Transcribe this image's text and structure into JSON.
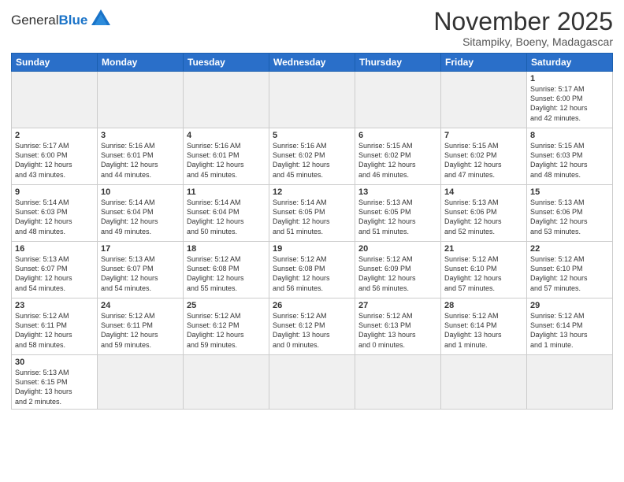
{
  "logo": {
    "text_general": "General",
    "text_blue": "Blue"
  },
  "title": "November 2025",
  "location": "Sitampiky, Boeny, Madagascar",
  "days_of_week": [
    "Sunday",
    "Monday",
    "Tuesday",
    "Wednesday",
    "Thursday",
    "Friday",
    "Saturday"
  ],
  "weeks": [
    [
      {
        "day": "",
        "info": ""
      },
      {
        "day": "",
        "info": ""
      },
      {
        "day": "",
        "info": ""
      },
      {
        "day": "",
        "info": ""
      },
      {
        "day": "",
        "info": ""
      },
      {
        "day": "",
        "info": ""
      },
      {
        "day": "1",
        "info": "Sunrise: 5:17 AM\nSunset: 6:00 PM\nDaylight: 12 hours\nand 42 minutes."
      }
    ],
    [
      {
        "day": "2",
        "info": "Sunrise: 5:17 AM\nSunset: 6:00 PM\nDaylight: 12 hours\nand 43 minutes."
      },
      {
        "day": "3",
        "info": "Sunrise: 5:16 AM\nSunset: 6:01 PM\nDaylight: 12 hours\nand 44 minutes."
      },
      {
        "day": "4",
        "info": "Sunrise: 5:16 AM\nSunset: 6:01 PM\nDaylight: 12 hours\nand 45 minutes."
      },
      {
        "day": "5",
        "info": "Sunrise: 5:16 AM\nSunset: 6:02 PM\nDaylight: 12 hours\nand 45 minutes."
      },
      {
        "day": "6",
        "info": "Sunrise: 5:15 AM\nSunset: 6:02 PM\nDaylight: 12 hours\nand 46 minutes."
      },
      {
        "day": "7",
        "info": "Sunrise: 5:15 AM\nSunset: 6:02 PM\nDaylight: 12 hours\nand 47 minutes."
      },
      {
        "day": "8",
        "info": "Sunrise: 5:15 AM\nSunset: 6:03 PM\nDaylight: 12 hours\nand 48 minutes."
      }
    ],
    [
      {
        "day": "9",
        "info": "Sunrise: 5:14 AM\nSunset: 6:03 PM\nDaylight: 12 hours\nand 48 minutes."
      },
      {
        "day": "10",
        "info": "Sunrise: 5:14 AM\nSunset: 6:04 PM\nDaylight: 12 hours\nand 49 minutes."
      },
      {
        "day": "11",
        "info": "Sunrise: 5:14 AM\nSunset: 6:04 PM\nDaylight: 12 hours\nand 50 minutes."
      },
      {
        "day": "12",
        "info": "Sunrise: 5:14 AM\nSunset: 6:05 PM\nDaylight: 12 hours\nand 51 minutes."
      },
      {
        "day": "13",
        "info": "Sunrise: 5:13 AM\nSunset: 6:05 PM\nDaylight: 12 hours\nand 51 minutes."
      },
      {
        "day": "14",
        "info": "Sunrise: 5:13 AM\nSunset: 6:06 PM\nDaylight: 12 hours\nand 52 minutes."
      },
      {
        "day": "15",
        "info": "Sunrise: 5:13 AM\nSunset: 6:06 PM\nDaylight: 12 hours\nand 53 minutes."
      }
    ],
    [
      {
        "day": "16",
        "info": "Sunrise: 5:13 AM\nSunset: 6:07 PM\nDaylight: 12 hours\nand 54 minutes."
      },
      {
        "day": "17",
        "info": "Sunrise: 5:13 AM\nSunset: 6:07 PM\nDaylight: 12 hours\nand 54 minutes."
      },
      {
        "day": "18",
        "info": "Sunrise: 5:12 AM\nSunset: 6:08 PM\nDaylight: 12 hours\nand 55 minutes."
      },
      {
        "day": "19",
        "info": "Sunrise: 5:12 AM\nSunset: 6:08 PM\nDaylight: 12 hours\nand 56 minutes."
      },
      {
        "day": "20",
        "info": "Sunrise: 5:12 AM\nSunset: 6:09 PM\nDaylight: 12 hours\nand 56 minutes."
      },
      {
        "day": "21",
        "info": "Sunrise: 5:12 AM\nSunset: 6:10 PM\nDaylight: 12 hours\nand 57 minutes."
      },
      {
        "day": "22",
        "info": "Sunrise: 5:12 AM\nSunset: 6:10 PM\nDaylight: 12 hours\nand 57 minutes."
      }
    ],
    [
      {
        "day": "23",
        "info": "Sunrise: 5:12 AM\nSunset: 6:11 PM\nDaylight: 12 hours\nand 58 minutes."
      },
      {
        "day": "24",
        "info": "Sunrise: 5:12 AM\nSunset: 6:11 PM\nDaylight: 12 hours\nand 59 minutes."
      },
      {
        "day": "25",
        "info": "Sunrise: 5:12 AM\nSunset: 6:12 PM\nDaylight: 12 hours\nand 59 minutes."
      },
      {
        "day": "26",
        "info": "Sunrise: 5:12 AM\nSunset: 6:12 PM\nDaylight: 13 hours\nand 0 minutes."
      },
      {
        "day": "27",
        "info": "Sunrise: 5:12 AM\nSunset: 6:13 PM\nDaylight: 13 hours\nand 0 minutes."
      },
      {
        "day": "28",
        "info": "Sunrise: 5:12 AM\nSunset: 6:14 PM\nDaylight: 13 hours\nand 1 minute."
      },
      {
        "day": "29",
        "info": "Sunrise: 5:12 AM\nSunset: 6:14 PM\nDaylight: 13 hours\nand 1 minute."
      }
    ],
    [
      {
        "day": "30",
        "info": "Sunrise: 5:13 AM\nSunset: 6:15 PM\nDaylight: 13 hours\nand 2 minutes."
      },
      {
        "day": "",
        "info": ""
      },
      {
        "day": "",
        "info": ""
      },
      {
        "day": "",
        "info": ""
      },
      {
        "day": "",
        "info": ""
      },
      {
        "day": "",
        "info": ""
      },
      {
        "day": "",
        "info": ""
      }
    ]
  ],
  "colors": {
    "header_bg": "#2a6fc9",
    "header_text": "#ffffff",
    "border": "#cccccc",
    "gray_bg": "#f0f0f0"
  }
}
